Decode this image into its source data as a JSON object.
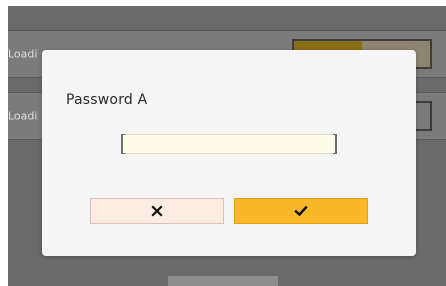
{
  "background": {
    "row_1": {
      "label": "Loadi"
    },
    "row_2": {
      "label": "Loadi"
    }
  },
  "dialog": {
    "title": "Password A",
    "password_input": {
      "value": "",
      "placeholder": ""
    },
    "buttons": {
      "cancel_icon": "close-icon",
      "confirm_icon": "check-icon"
    }
  },
  "colors": {
    "screen_bg": "#6a6a6a",
    "dialog_bg": "#f5f5f5",
    "input_bg": "#fffbe8",
    "cancel_bg": "#fdece4",
    "confirm_bg": "#f8b82a"
  }
}
